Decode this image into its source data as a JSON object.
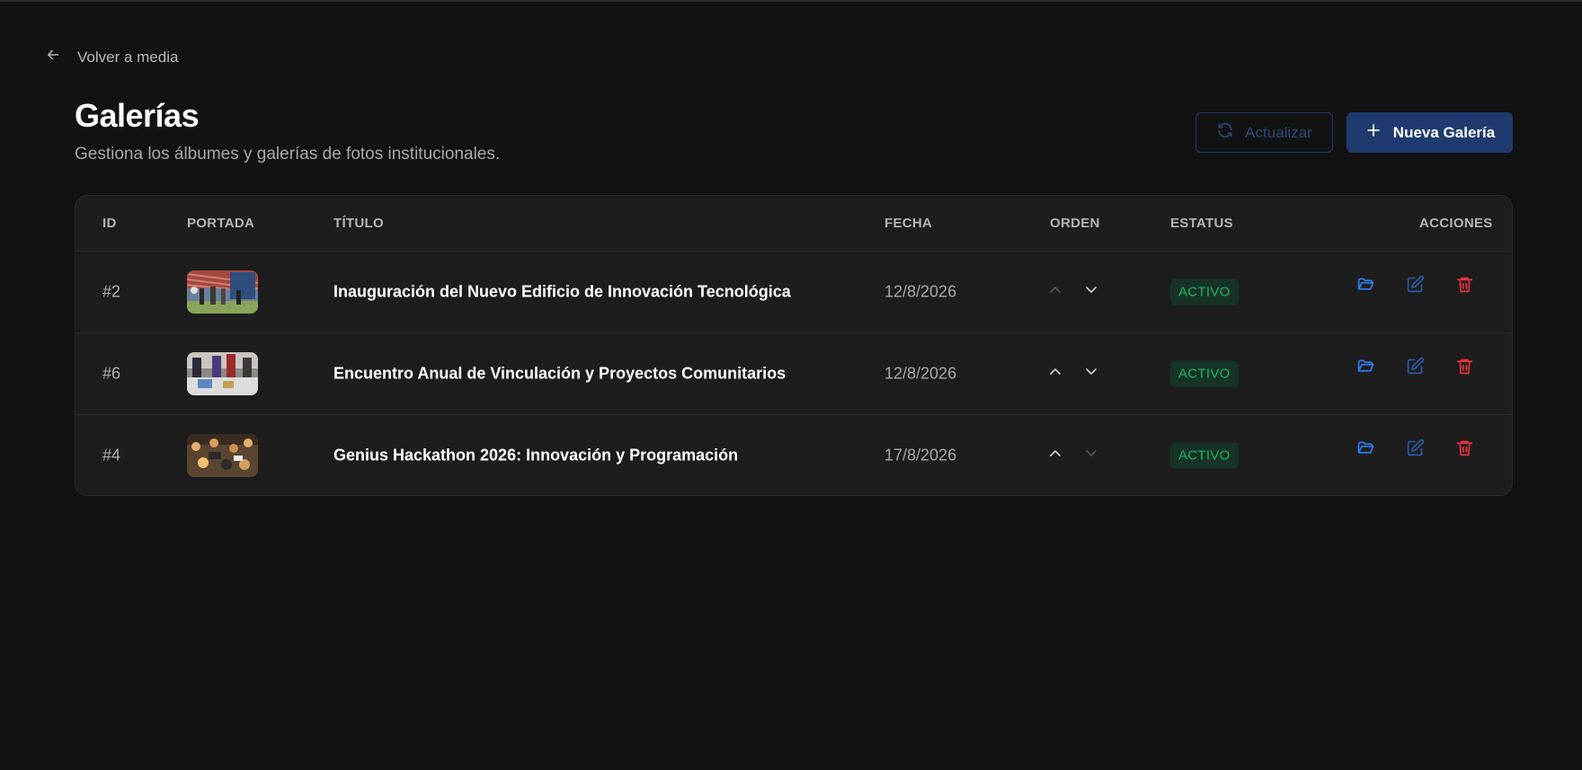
{
  "nav": {
    "back_label": "Volver a media"
  },
  "header": {
    "title": "Galerías",
    "subtitle": "Gestiona los álbumes y galerías de fotos institucionales.",
    "refresh_label": "Actualizar",
    "new_label": "Nueva Galería"
  },
  "table": {
    "columns": [
      "ID",
      "PORTADA",
      "TÍTULO",
      "FECHA",
      "ORDEN",
      "ESTATUS",
      "ACCIONES"
    ],
    "rows": [
      {
        "id": "#2",
        "title": "Inauguración del Nuevo Edificio de Innovación Tecnológica",
        "date": "12/8/2026",
        "status": "ACTIVO",
        "thumb": "building-inauguration"
      },
      {
        "id": "#6",
        "title": "Encuentro Anual de Vinculación y Proyectos Comunitarios",
        "date": "12/8/2026",
        "status": "ACTIVO",
        "thumb": "community-fair"
      },
      {
        "id": "#4",
        "title": "Genius Hackathon 2026: Innovación y Programación",
        "date": "17/8/2026",
        "status": "ACTIVO",
        "thumb": "hackathon-room"
      }
    ]
  },
  "colors": {
    "background": "#121212",
    "card": "#1d1d1d",
    "accent": "#1e3a6e",
    "action_blue": "#2f7bef",
    "danger": "#e5323e",
    "status_green": "#22b565"
  },
  "icons": [
    "arrow-left-icon",
    "refresh-icon",
    "plus-icon",
    "chevron-up-icon",
    "chevron-down-icon",
    "folder-open-icon",
    "edit-icon",
    "trash-icon"
  ]
}
